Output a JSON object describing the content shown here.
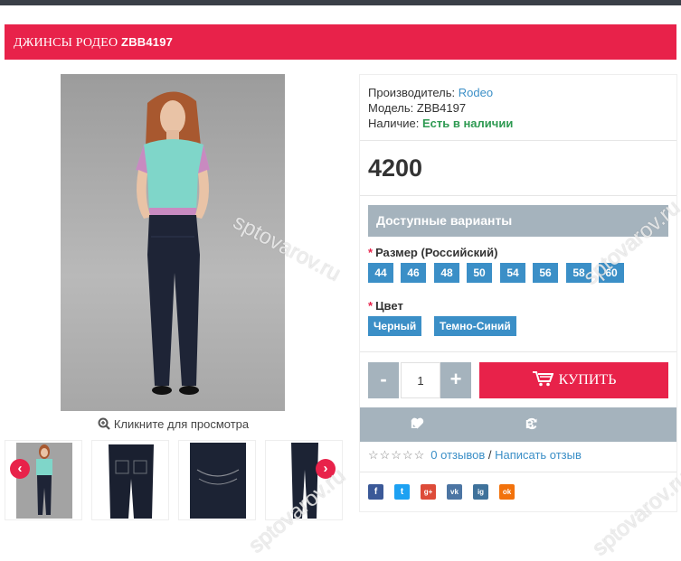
{
  "product": {
    "title_prefix": "ДЖИНСЫ РОДЕО ",
    "title_model": "ZBB4197",
    "manufacturer_label": "Производитель: ",
    "manufacturer_value": "Rodeo",
    "model_label": "Модель: ",
    "model_value": "ZBB4197",
    "availability_label": "Наличие: ",
    "availability_value": "Есть в наличии",
    "price": "4200"
  },
  "gallery": {
    "zoom_hint": "Кликните для просмотра",
    "prev_arrow": "‹",
    "next_arrow": "›",
    "thumbnails": [
      "model-top",
      "jeans-back",
      "jeans-pocket",
      "jeans-legs"
    ]
  },
  "variants": {
    "heading": "Доступные варианты",
    "size_label": "Размер (Российский)",
    "sizes": [
      "44",
      "46",
      "48",
      "50",
      "54",
      "56",
      "58",
      "60"
    ],
    "color_label": "Цвет",
    "colors": [
      "Черный",
      "Темно-Синий"
    ],
    "required_mark": "*"
  },
  "purchase": {
    "minus": "-",
    "plus": "+",
    "quantity": "1",
    "buy_label": "КУПИТЬ"
  },
  "actions": {
    "bookmark_label": "В закладки",
    "compare_label": "В сравнение"
  },
  "reviews": {
    "stars": "☆☆☆☆☆",
    "count_label": "0 отзывов",
    "separator": " / ",
    "write_label": "Написать отзыв"
  },
  "social": [
    "f",
    "t",
    "g+",
    "vk",
    "ig",
    "ok"
  ],
  "watermark": "sptovarov.ru",
  "colors": {
    "accent_red": "#e8224a",
    "link_blue": "#3b8fc7",
    "gray_bar": "#a5b3bd",
    "in_stock_green": "#2e9a52"
  }
}
